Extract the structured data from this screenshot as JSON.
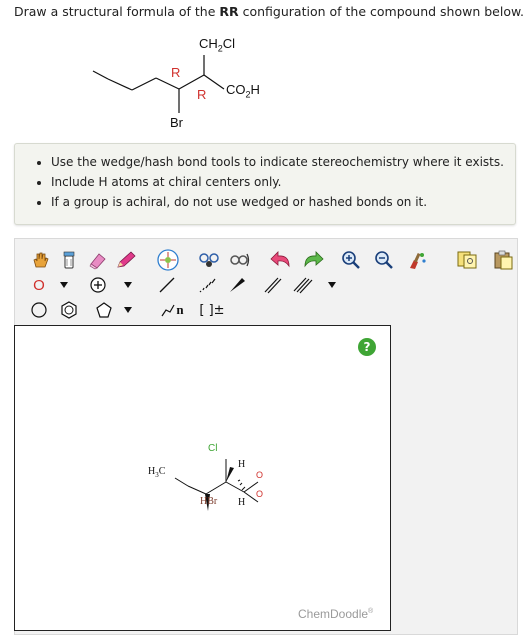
{
  "question": {
    "prefix": "Draw a structural formula of the ",
    "highlight": "RR",
    "suffix": " configuration of the compound shown below."
  },
  "molecule": {
    "top_group": "CH2Cl",
    "right_group": "CO2H",
    "bottom_group": "Br",
    "label_r1": "R",
    "label_r2": "R"
  },
  "instructions": [
    "Use the wedge/hash bond tools to indicate stereochemistry where it exists.",
    "Include H atoms at chiral centers only.",
    "If a group is achiral, do not use wedged or hashed bonds on it."
  ],
  "toolbar": {
    "element_button": "O",
    "chain_n": "n",
    "brackets": "[ ]±"
  },
  "canvas": {
    "atom_cl": "Cl",
    "atom_h3c": "H3C",
    "atom_h_upper": "H",
    "atom_o_top": "O",
    "atom_o_bottom": "O",
    "atom_hbr": "HBr",
    "atom_h_lower": "H"
  },
  "help_label": "?",
  "brand": "ChemDoodle",
  "brand_mark": "®",
  "colors": {
    "r_label": "#d0312d",
    "help": "#3fa535",
    "panel": "#f3f4ef"
  }
}
